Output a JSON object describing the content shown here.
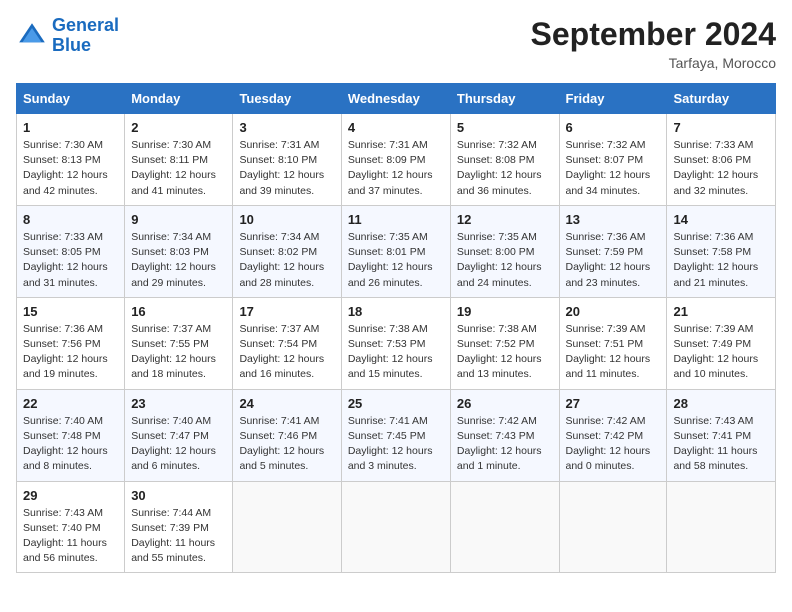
{
  "header": {
    "logo_line1": "General",
    "logo_line2": "Blue",
    "month": "September 2024",
    "location": "Tarfaya, Morocco"
  },
  "days_of_week": [
    "Sunday",
    "Monday",
    "Tuesday",
    "Wednesday",
    "Thursday",
    "Friday",
    "Saturday"
  ],
  "weeks": [
    [
      {
        "day": "1",
        "sunrise": "7:30 AM",
        "sunset": "8:13 PM",
        "daylight": "12 hours and 42 minutes."
      },
      {
        "day": "2",
        "sunrise": "7:30 AM",
        "sunset": "8:11 PM",
        "daylight": "12 hours and 41 minutes."
      },
      {
        "day": "3",
        "sunrise": "7:31 AM",
        "sunset": "8:10 PM",
        "daylight": "12 hours and 39 minutes."
      },
      {
        "day": "4",
        "sunrise": "7:31 AM",
        "sunset": "8:09 PM",
        "daylight": "12 hours and 37 minutes."
      },
      {
        "day": "5",
        "sunrise": "7:32 AM",
        "sunset": "8:08 PM",
        "daylight": "12 hours and 36 minutes."
      },
      {
        "day": "6",
        "sunrise": "7:32 AM",
        "sunset": "8:07 PM",
        "daylight": "12 hours and 34 minutes."
      },
      {
        "day": "7",
        "sunrise": "7:33 AM",
        "sunset": "8:06 PM",
        "daylight": "12 hours and 32 minutes."
      }
    ],
    [
      {
        "day": "8",
        "sunrise": "7:33 AM",
        "sunset": "8:05 PM",
        "daylight": "12 hours and 31 minutes."
      },
      {
        "day": "9",
        "sunrise": "7:34 AM",
        "sunset": "8:03 PM",
        "daylight": "12 hours and 29 minutes."
      },
      {
        "day": "10",
        "sunrise": "7:34 AM",
        "sunset": "8:02 PM",
        "daylight": "12 hours and 28 minutes."
      },
      {
        "day": "11",
        "sunrise": "7:35 AM",
        "sunset": "8:01 PM",
        "daylight": "12 hours and 26 minutes."
      },
      {
        "day": "12",
        "sunrise": "7:35 AM",
        "sunset": "8:00 PM",
        "daylight": "12 hours and 24 minutes."
      },
      {
        "day": "13",
        "sunrise": "7:36 AM",
        "sunset": "7:59 PM",
        "daylight": "12 hours and 23 minutes."
      },
      {
        "day": "14",
        "sunrise": "7:36 AM",
        "sunset": "7:58 PM",
        "daylight": "12 hours and 21 minutes."
      }
    ],
    [
      {
        "day": "15",
        "sunrise": "7:36 AM",
        "sunset": "7:56 PM",
        "daylight": "12 hours and 19 minutes."
      },
      {
        "day": "16",
        "sunrise": "7:37 AM",
        "sunset": "7:55 PM",
        "daylight": "12 hours and 18 minutes."
      },
      {
        "day": "17",
        "sunrise": "7:37 AM",
        "sunset": "7:54 PM",
        "daylight": "12 hours and 16 minutes."
      },
      {
        "day": "18",
        "sunrise": "7:38 AM",
        "sunset": "7:53 PM",
        "daylight": "12 hours and 15 minutes."
      },
      {
        "day": "19",
        "sunrise": "7:38 AM",
        "sunset": "7:52 PM",
        "daylight": "12 hours and 13 minutes."
      },
      {
        "day": "20",
        "sunrise": "7:39 AM",
        "sunset": "7:51 PM",
        "daylight": "12 hours and 11 minutes."
      },
      {
        "day": "21",
        "sunrise": "7:39 AM",
        "sunset": "7:49 PM",
        "daylight": "12 hours and 10 minutes."
      }
    ],
    [
      {
        "day": "22",
        "sunrise": "7:40 AM",
        "sunset": "7:48 PM",
        "daylight": "12 hours and 8 minutes."
      },
      {
        "day": "23",
        "sunrise": "7:40 AM",
        "sunset": "7:47 PM",
        "daylight": "12 hours and 6 minutes."
      },
      {
        "day": "24",
        "sunrise": "7:41 AM",
        "sunset": "7:46 PM",
        "daylight": "12 hours and 5 minutes."
      },
      {
        "day": "25",
        "sunrise": "7:41 AM",
        "sunset": "7:45 PM",
        "daylight": "12 hours and 3 minutes."
      },
      {
        "day": "26",
        "sunrise": "7:42 AM",
        "sunset": "7:43 PM",
        "daylight": "12 hours and 1 minute."
      },
      {
        "day": "27",
        "sunrise": "7:42 AM",
        "sunset": "7:42 PM",
        "daylight": "12 hours and 0 minutes."
      },
      {
        "day": "28",
        "sunrise": "7:43 AM",
        "sunset": "7:41 PM",
        "daylight": "11 hours and 58 minutes."
      }
    ],
    [
      {
        "day": "29",
        "sunrise": "7:43 AM",
        "sunset": "7:40 PM",
        "daylight": "11 hours and 56 minutes."
      },
      {
        "day": "30",
        "sunrise": "7:44 AM",
        "sunset": "7:39 PM",
        "daylight": "11 hours and 55 minutes."
      },
      null,
      null,
      null,
      null,
      null
    ]
  ],
  "labels": {
    "sunrise": "Sunrise:",
    "sunset": "Sunset:",
    "daylight": "Daylight:"
  }
}
